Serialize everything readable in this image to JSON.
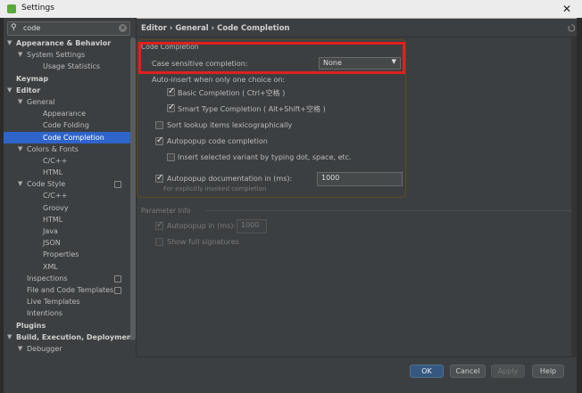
{
  "window": {
    "title": "Settings",
    "close": "✕"
  },
  "search": {
    "value": "code"
  },
  "tree": [
    {
      "label": "Appearance & Behavior",
      "level": 0,
      "arrow": "▼",
      "bold": true
    },
    {
      "label": "System Settings",
      "level": 1,
      "arrow": "▼"
    },
    {
      "label": "Usage Statistics",
      "level": 2
    },
    {
      "label": "Keymap",
      "level": 0,
      "bold": true
    },
    {
      "label": "Editor",
      "level": 0,
      "arrow": "▼",
      "bold": true
    },
    {
      "label": "General",
      "level": 1,
      "arrow": "▼"
    },
    {
      "label": "Appearance",
      "level": 2
    },
    {
      "label": "Code Folding",
      "level": 2
    },
    {
      "label": "Code Completion",
      "level": 2,
      "selected": true
    },
    {
      "label": "Colors & Fonts",
      "level": 1,
      "arrow": "▼"
    },
    {
      "label": "C/C++",
      "level": 2
    },
    {
      "label": "HTML",
      "level": 2
    },
    {
      "label": "Code Style",
      "level": 1,
      "arrow": "▼",
      "project": true
    },
    {
      "label": "C/C++",
      "level": 2
    },
    {
      "label": "Groovy",
      "level": 2
    },
    {
      "label": "HTML",
      "level": 2
    },
    {
      "label": "Java",
      "level": 2
    },
    {
      "label": "JSON",
      "level": 2
    },
    {
      "label": "Properties",
      "level": 2
    },
    {
      "label": "XML",
      "level": 2
    },
    {
      "label": "Inspections",
      "level": 1,
      "project": true
    },
    {
      "label": "File and Code Templates",
      "level": 1,
      "project": true
    },
    {
      "label": "Live Templates",
      "level": 1
    },
    {
      "label": "Intentions",
      "level": 1
    },
    {
      "label": "Plugins",
      "level": 0,
      "bold": true
    },
    {
      "label": "Build, Execution, Deployment",
      "level": 0,
      "arrow": "▼",
      "bold": true
    },
    {
      "label": "Debugger",
      "level": 1,
      "arrow": "▼"
    }
  ],
  "breadcrumb": "Editor › General › Code Completion",
  "code_completion": {
    "section_title": "Code Completion",
    "case_label": "Case sensitive completion:",
    "case_value": "None",
    "auto_insert_label": "Auto-insert when only one choice on:",
    "basic": "Basic Completion ( Ctrl+空格 )",
    "smart": "Smart Type Completion ( Alt+Shift+空格 )",
    "sort": "Sort lookup items lexicographically",
    "autopopup": "Autopopup code completion",
    "insert_selected": "Insert selected variant by typing dot, space, etc.",
    "autopopup_doc": "Autopopup documentation in (ms):",
    "autopopup_doc_value": "1000",
    "explicit_hint": "For explicitly invoked completion"
  },
  "parameter_info": {
    "section_title": "Parameter Info",
    "autopopup": "Autopopup in (ms):",
    "autopopup_value": "1000",
    "show_full": "Show full signatures"
  },
  "buttons": {
    "ok": "OK",
    "cancel": "Cancel",
    "apply": "Apply",
    "help": "Help"
  },
  "icons": {
    "app": "android-studio-icon",
    "search": "magnifier-icon",
    "dropdown": "triangle-down-icon"
  }
}
